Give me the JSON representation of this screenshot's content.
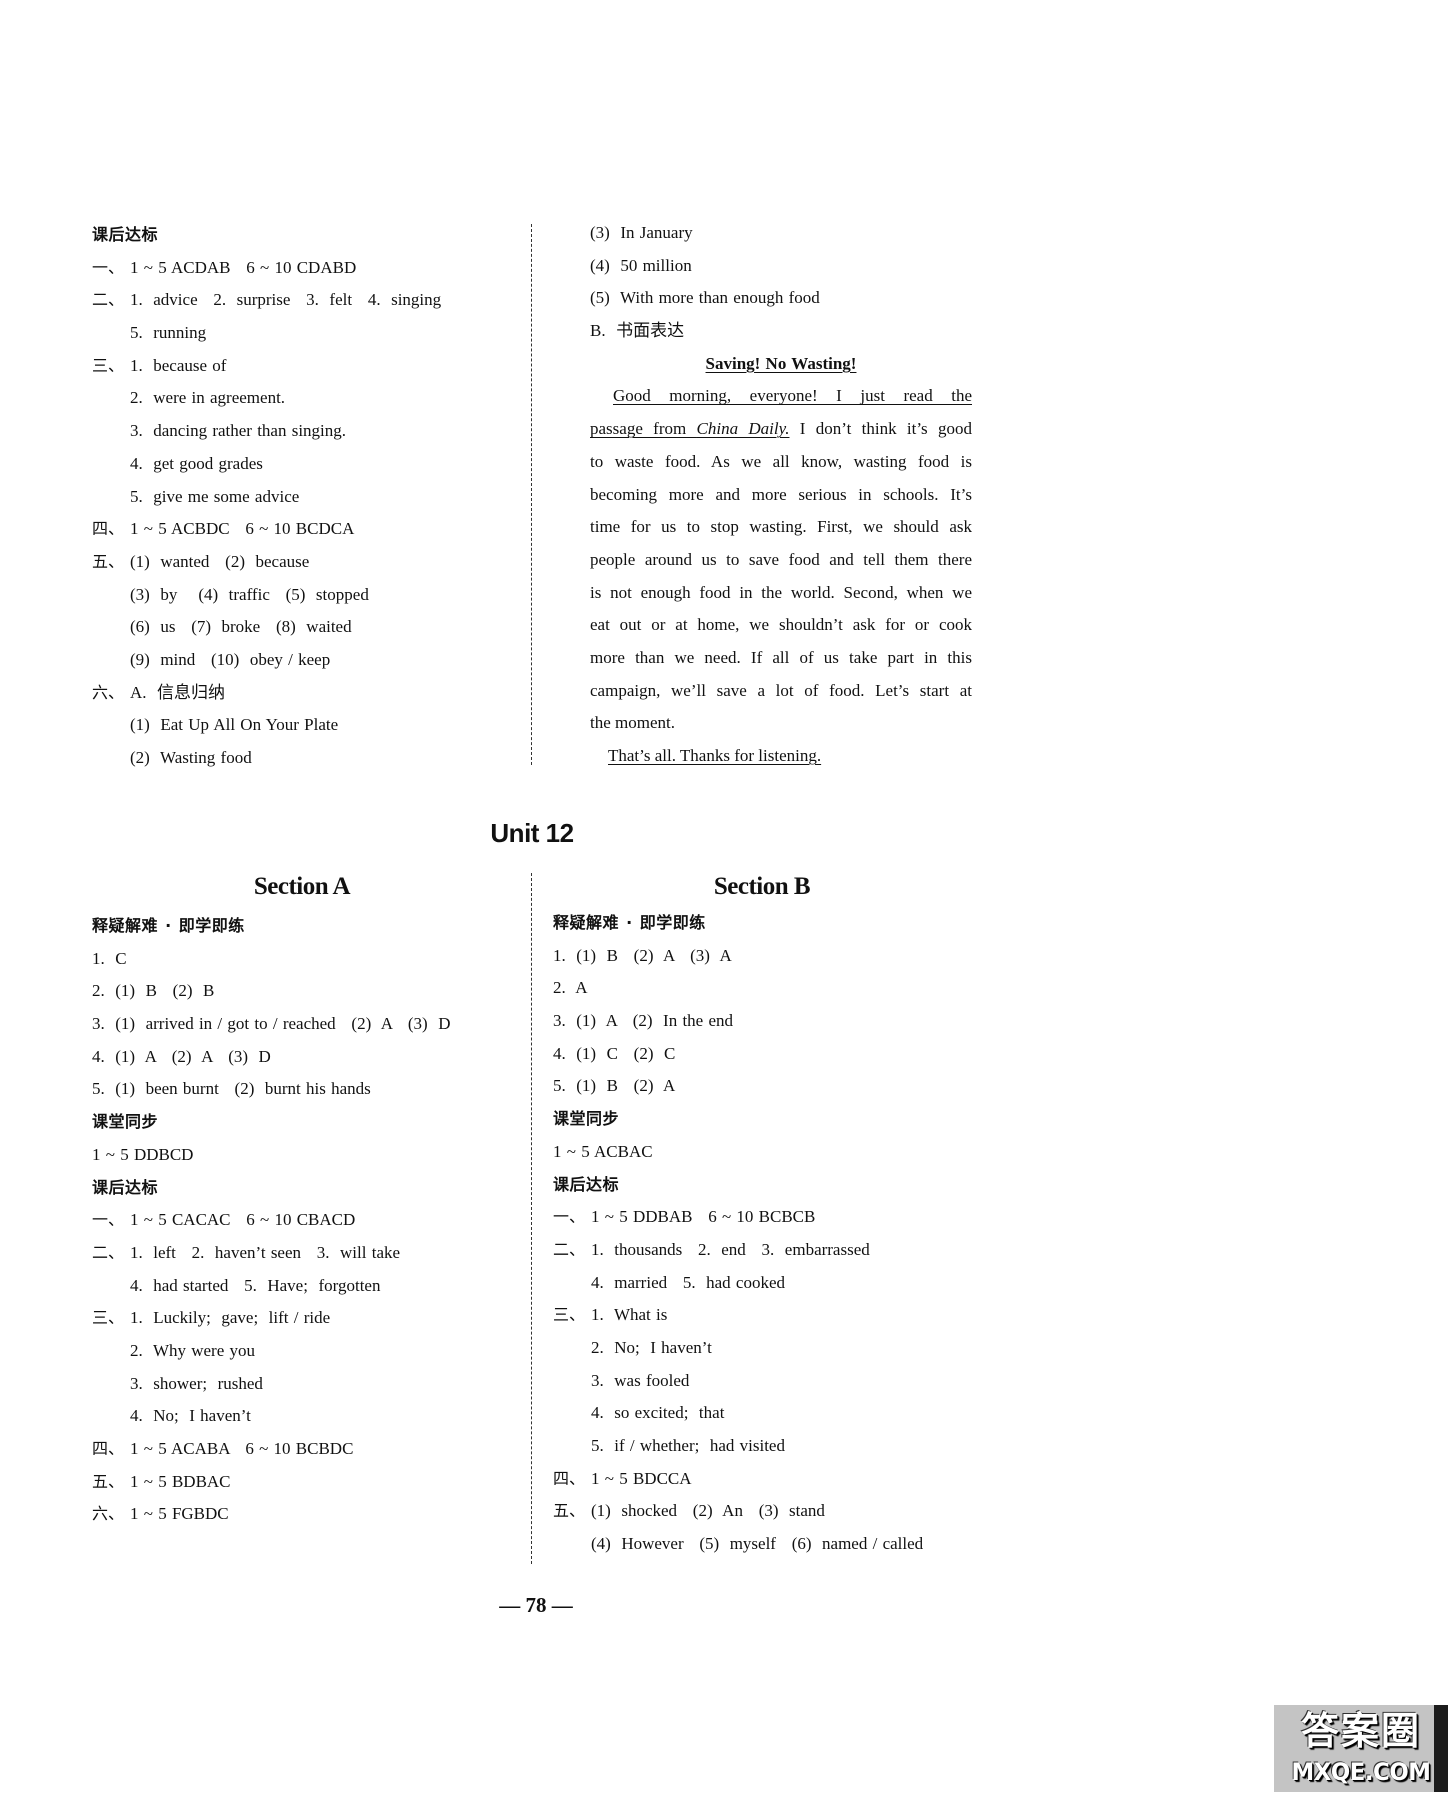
{
  "document": {
    "unit_title": "Unit 12",
    "page_number": "— 78 —"
  },
  "top_left": {
    "lines": [
      {
        "text": "课后达标"
      },
      {
        "prefix": "一、",
        "text": "1 ~ 5 ACDAB   6 ~ 10 CDABD"
      },
      {
        "prefix": "二、",
        "text": "1.  advice   2.  surprise   3.  felt   4.  singing"
      },
      {
        "text": "5.  running"
      },
      {
        "prefix": "三、",
        "text": "1.  because of"
      },
      {
        "text": "2.  were in agreement."
      },
      {
        "text": "3.  dancing rather than singing."
      },
      {
        "text": "4.  get good grades"
      },
      {
        "text": "5.  give me some advice"
      },
      {
        "prefix": "四、",
        "text": "1 ~ 5 ACBDC   6 ~ 10 BCDCA"
      },
      {
        "prefix": "五、",
        "text": "(1)  wanted   (2)  because"
      },
      {
        "text": "(3)  by    (4)  traffic   (5)  stopped"
      },
      {
        "text": "(6)  us   (7)  broke   (8)  waited"
      },
      {
        "text": "(9)  mind   (10)  obey / keep"
      },
      {
        "prefix": "六、",
        "text": "A.  信息归纳"
      },
      {
        "text": "(1)  Eat Up All On Your Plate"
      },
      {
        "text": "(2)  Wasting food"
      }
    ]
  },
  "top_right": {
    "answers": [
      "(3)  In January",
      "(4)  50 million",
      "(5)  With more than enough food",
      "B.  书面表达"
    ],
    "essay": {
      "title": "Saving! No Wasting!",
      "opening": "Good morning, everyone! I just read the",
      "line2": {
        "underlined": "passage from ",
        "source": "China Daily.",
        "rest": " I don’t think it’s good"
      },
      "body_lines": [
        "to waste food. As we all know, wasting food is",
        "becoming more and more serious in schools. It’s",
        "time for us to stop wasting. First, we should ask",
        "people around us to save food and tell them there",
        "is not enough food in the world. Second, when we",
        "eat out or at home, we shouldn’t ask for or cook",
        "more than we need. If all of us take part in this",
        "campaign, we’ll save a lot of food. Let’s start at"
      ],
      "last_line": "the moment.",
      "closing": "That’s all. Thanks for listening."
    }
  },
  "section_a": {
    "title": "Section A",
    "lines": [
      {
        "text": "释疑解难 · 即学即练"
      },
      {
        "text": "1.  C"
      },
      {
        "text": "2.  (1)  B   (2)  B"
      },
      {
        "text": "3.  (1)  arrived in / got to / reached   (2)  A   (3)  D"
      },
      {
        "text": "4.  (1)  A   (2)  A   (3)  D"
      },
      {
        "text": "5.  (1)  been burnt   (2)  burnt his hands"
      },
      {
        "text": "课堂同步"
      },
      {
        "text": "1 ~ 5 DDBCD"
      },
      {
        "text": "课后达标"
      },
      {
        "prefix": "一、",
        "text": "1 ~ 5 CACAC   6 ~ 10 CBACD"
      },
      {
        "prefix": "二、",
        "text": "1.  left   2.  haven’t seen   3.  will take"
      },
      {
        "text": "4.  had started   5.  Have;  forgotten"
      },
      {
        "prefix": "三、",
        "text": "1.  Luckily;  gave;  lift / ride"
      },
      {
        "text": "2.  Why were you"
      },
      {
        "text": "3.  shower;  rushed"
      },
      {
        "text": "4.  No;  I haven’t"
      },
      {
        "prefix": "四、",
        "text": "1 ~ 5 ACABA   6 ~ 10 BCBDC"
      },
      {
        "prefix": "五、",
        "text": "1 ~ 5 BDBAC"
      },
      {
        "prefix": "六、",
        "text": "1 ~ 5 FGBDC"
      }
    ]
  },
  "section_b": {
    "title": "Section B",
    "lines": [
      {
        "text": "释疑解难 · 即学即练"
      },
      {
        "text": "1.  (1)  B   (2)  A   (3)  A"
      },
      {
        "text": "2.  A"
      },
      {
        "text": "3.  (1)  A   (2)  In the end"
      },
      {
        "text": "4.  (1)  C   (2)  C"
      },
      {
        "text": "5.  (1)  B   (2)  A"
      },
      {
        "text": "课堂同步"
      },
      {
        "text": "1 ~ 5 ACBAC"
      },
      {
        "text": "课后达标"
      },
      {
        "prefix": "一、",
        "text": "1 ~ 5 DDBAB   6 ~ 10 BCBCB"
      },
      {
        "prefix": "二、",
        "text": "1.  thousands   2.  end   3.  embarrassed"
      },
      {
        "text": "4.  married   5.  had cooked"
      },
      {
        "prefix": "三、",
        "text": "1.  What is"
      },
      {
        "text": "2.  No;  I haven’t"
      },
      {
        "text": "3.  was fooled"
      },
      {
        "text": "4.  so excited;  that"
      },
      {
        "text": "5.  if / whether;  had visited"
      },
      {
        "prefix": "四、",
        "text": "1 ~ 5 BDCCA"
      },
      {
        "prefix": "五、",
        "text": "(1)  shocked   (2)  An   (3)  stand"
      },
      {
        "text": "(4)  However   (5)  myself   (6)  named / called"
      }
    ]
  },
  "watermark": {
    "line1": "答案圈",
    "line2": "MXQE.COM"
  }
}
